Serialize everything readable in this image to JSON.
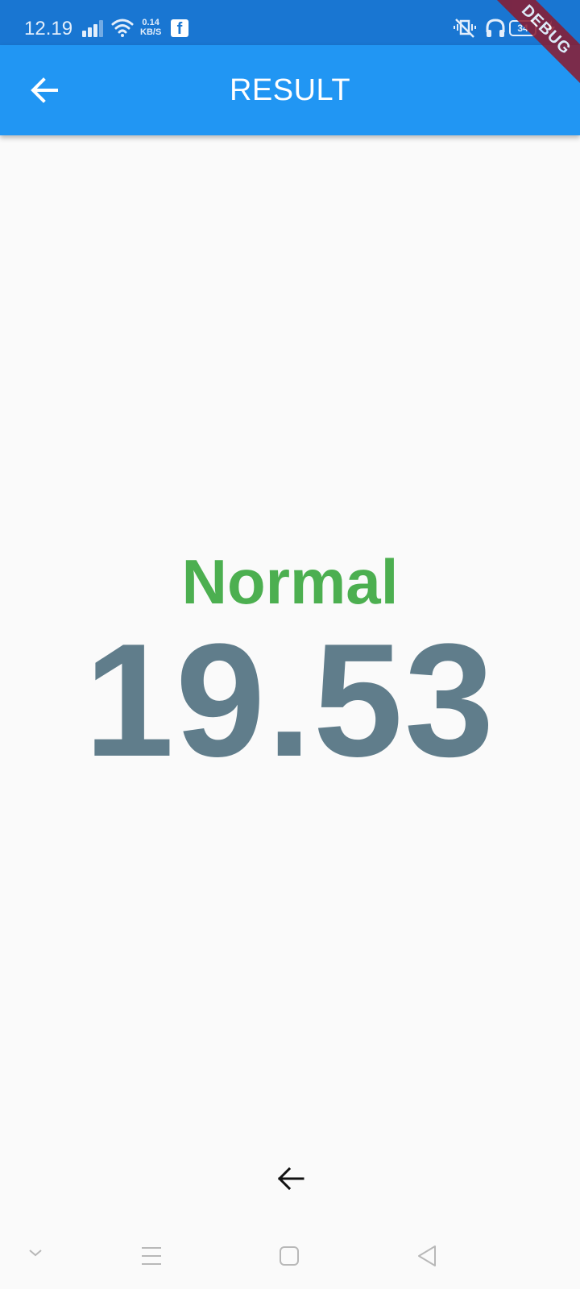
{
  "status_bar": {
    "time": "12.19",
    "speed_value": "0.14",
    "speed_unit": "KB/S",
    "battery": "34",
    "icons": [
      "signal-icon",
      "wifi-icon",
      "facebook-icon",
      "vibrate-off-icon",
      "headset-icon",
      "battery-icon",
      "charging-icon"
    ]
  },
  "app_bar": {
    "title": "RESULT",
    "back_icon": "arrow-back-icon",
    "color": "#2196f3"
  },
  "debug_banner": {
    "label": "DEBUG",
    "color": "#8b1a2e"
  },
  "result": {
    "category": "Normal",
    "category_color": "#4caf50",
    "value": "19.53",
    "value_color": "#607d8b"
  },
  "bottom_action": {
    "icon": "arrow-back-icon"
  },
  "system_nav": {
    "icons": [
      "chevron-down-icon",
      "menu-icon",
      "home-icon",
      "back-triangle-icon"
    ]
  }
}
